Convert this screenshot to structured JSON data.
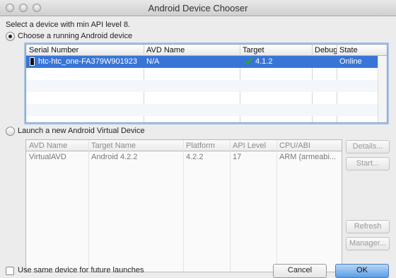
{
  "window": {
    "title": "Android Device Chooser"
  },
  "prompt": "Select a device with min API level 8.",
  "running": {
    "radio_label": "Choose a running Android device",
    "columns": [
      "Serial Number",
      "AVD Name",
      "Target",
      "Debug",
      "State"
    ],
    "rows": [
      {
        "serial": "htc-htc_one-FA379W901923",
        "avd": "N/A",
        "target": "4.1.2",
        "debug": "",
        "state": "Online"
      }
    ]
  },
  "launch": {
    "radio_label": "Launch a new Android Virtual Device",
    "columns": [
      "AVD Name",
      "Target Name",
      "Platform",
      "API Level",
      "CPU/ABI"
    ],
    "rows": [
      {
        "name": "VirtualAVD",
        "target": "Android 4.2.2",
        "platform": "4.2.2",
        "api": "17",
        "cpu": "ARM (armeabi..."
      }
    ],
    "buttons": {
      "details": "Details...",
      "start": "Start...",
      "refresh": "Refresh",
      "manager": "Manager..."
    }
  },
  "footer": {
    "checkbox_label": "Use same device for future launches",
    "cancel": "Cancel",
    "ok": "OK"
  },
  "colors": {
    "selection": "#3875d7",
    "target_check": "#2fa52f"
  },
  "icons": {
    "device": "phone-icon",
    "target": "checkmark-icon"
  }
}
